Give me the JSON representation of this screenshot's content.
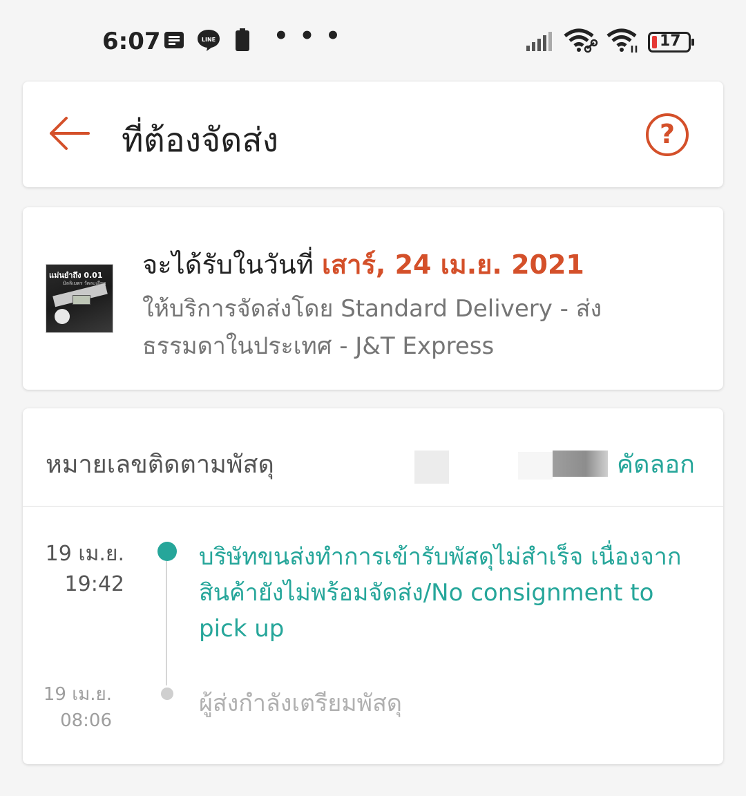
{
  "status_bar": {
    "time": "6:07",
    "icons": [
      "notes-icon",
      "line-app-icon",
      "battery-saver-icon"
    ],
    "more": "• • •",
    "right_icons": [
      "signal-icon",
      "wifi-link-icon",
      "wifi-icon"
    ],
    "battery_level": "17"
  },
  "header": {
    "title": "ที่ต้องจัดส่ง",
    "help": "?"
  },
  "delivery": {
    "thumb_label": "แม่นยำถึง 0.01",
    "thumb_sub": "มิลลิเมตร วัดละเอียด",
    "receive_prefix": "จะได้รับในวันที่ ",
    "receive_date": "เสาร์, 24 เม.ย. 2021",
    "service_text": "ให้บริการจัดส่งโดย Standard Delivery - ส่งธรรมดาในประเทศ - J&T Express"
  },
  "tracking": {
    "label": "หมายเลขติดตามพัสดุ",
    "copy_label": "คัดลอก",
    "events": [
      {
        "date": "19 เม.ย.",
        "time": "19:42",
        "text": "บริษัทขนส่งทำการเข้ารับพัสดุไม่สำเร็จ เนื่องจาก สินค้ายังไม่พร้อมจัดส่ง/No consignment to pick up"
      },
      {
        "date": "19 เม.ย.",
        "time": "08:06",
        "text": "ผู้ส่งกำลังเตรียมพัสดุ"
      }
    ]
  },
  "colors": {
    "accent": "#d4502a",
    "teal": "#26a69a"
  }
}
